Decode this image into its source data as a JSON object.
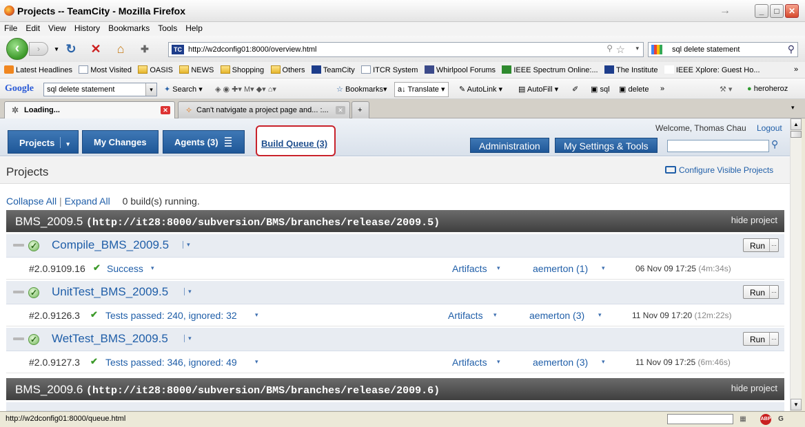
{
  "window": {
    "title": "Projects -- TeamCity - Mozilla Firefox"
  },
  "menu": [
    "File",
    "Edit",
    "View",
    "History",
    "Bookmarks",
    "Tools",
    "Help"
  ],
  "nav": {
    "url": "http://w2dconfig01:8000/overview.html",
    "search_value": "sql delete statement"
  },
  "bookmarks": [
    {
      "label": "Latest Headlines",
      "icon": "rss-icon"
    },
    {
      "label": "Most Visited",
      "icon": "folder-icon"
    },
    {
      "label": "OASIS",
      "icon": "folder-icon"
    },
    {
      "label": "NEWS",
      "icon": "folder-icon"
    },
    {
      "label": "Shopping",
      "icon": "folder-icon"
    },
    {
      "label": "Others",
      "icon": "folder-icon"
    },
    {
      "label": "TeamCity",
      "icon": "teamcity-icon"
    },
    {
      "label": "ITCR System",
      "icon": "page-icon"
    },
    {
      "label": "Whirlpool Forums",
      "icon": "page-icon"
    },
    {
      "label": "IEEE Spectrum Online:...",
      "icon": "page-icon"
    },
    {
      "label": "The Institute",
      "icon": "page-icon"
    },
    {
      "label": "IEEE Xplore: Guest Ho...",
      "icon": "page-icon"
    }
  ],
  "google_toolbar": {
    "logo": "Google",
    "query": "sql delete statement",
    "search": "Search",
    "bookmarks": "Bookmarks",
    "translate": "Translate",
    "autolink": "AutoLink",
    "autofill": "AutoFill",
    "sql": "sql",
    "delete": "delete",
    "more": "»",
    "user": "heroheroz"
  },
  "tabs": [
    {
      "label": "Loading...",
      "active": true
    },
    {
      "label": "Can't natvigate a project page and... :...",
      "active": false
    }
  ],
  "teamcity": {
    "nav_tabs": {
      "projects": "Projects",
      "my_changes": "My Changes",
      "agents": "Agents (3)",
      "build_queue": "Build Queue (3)"
    },
    "welcome": "Welcome, Thomas Chau",
    "logout": "Logout",
    "administration": "Administration",
    "my_settings": "My Settings & Tools",
    "page_title": "Projects",
    "configure_visible": "Configure Visible Projects",
    "collapse_all": "Collapse All",
    "expand_all": "Expand All",
    "running": "0 build(s) running.",
    "projects": [
      {
        "name": "BMS_2009.5",
        "url": "(http://it28:8000/subversion/BMS/branches/release/2009.5)",
        "hide": "hide project"
      },
      {
        "name": "BMS_2009.6",
        "url": "(http://it28:8000/subversion/BMS/branches/release/2009.6)",
        "hide": "hide project"
      }
    ],
    "build_types": [
      {
        "name": "Compile_BMS_2009.5",
        "run": "Run",
        "build": {
          "number": "#2.0.9109.16",
          "status": "Success",
          "artifacts": "Artifacts",
          "user": "aemerton (1)",
          "date": "06 Nov 09 17:25",
          "duration": "(4m:34s)"
        }
      },
      {
        "name": "UnitTest_BMS_2009.5",
        "run": "Run",
        "build": {
          "number": "#2.0.9126.3",
          "status": "Tests passed: 240, ignored: 32",
          "artifacts": "Artifacts",
          "user": "aemerton (3)",
          "date": "11 Nov 09 17:20",
          "duration": "(12m:22s)"
        }
      },
      {
        "name": "WetTest_BMS_2009.5",
        "run": "Run",
        "build": {
          "number": "#2.0.9127.3",
          "status": "Tests passed: 346, ignored: 49",
          "artifacts": "Artifacts",
          "user": "aemerton (3)",
          "date": "11 Nov 09 17:25",
          "duration": "(6m:46s)"
        }
      }
    ]
  },
  "status": {
    "text": "http://w2dconfig01:8000/queue.html"
  }
}
